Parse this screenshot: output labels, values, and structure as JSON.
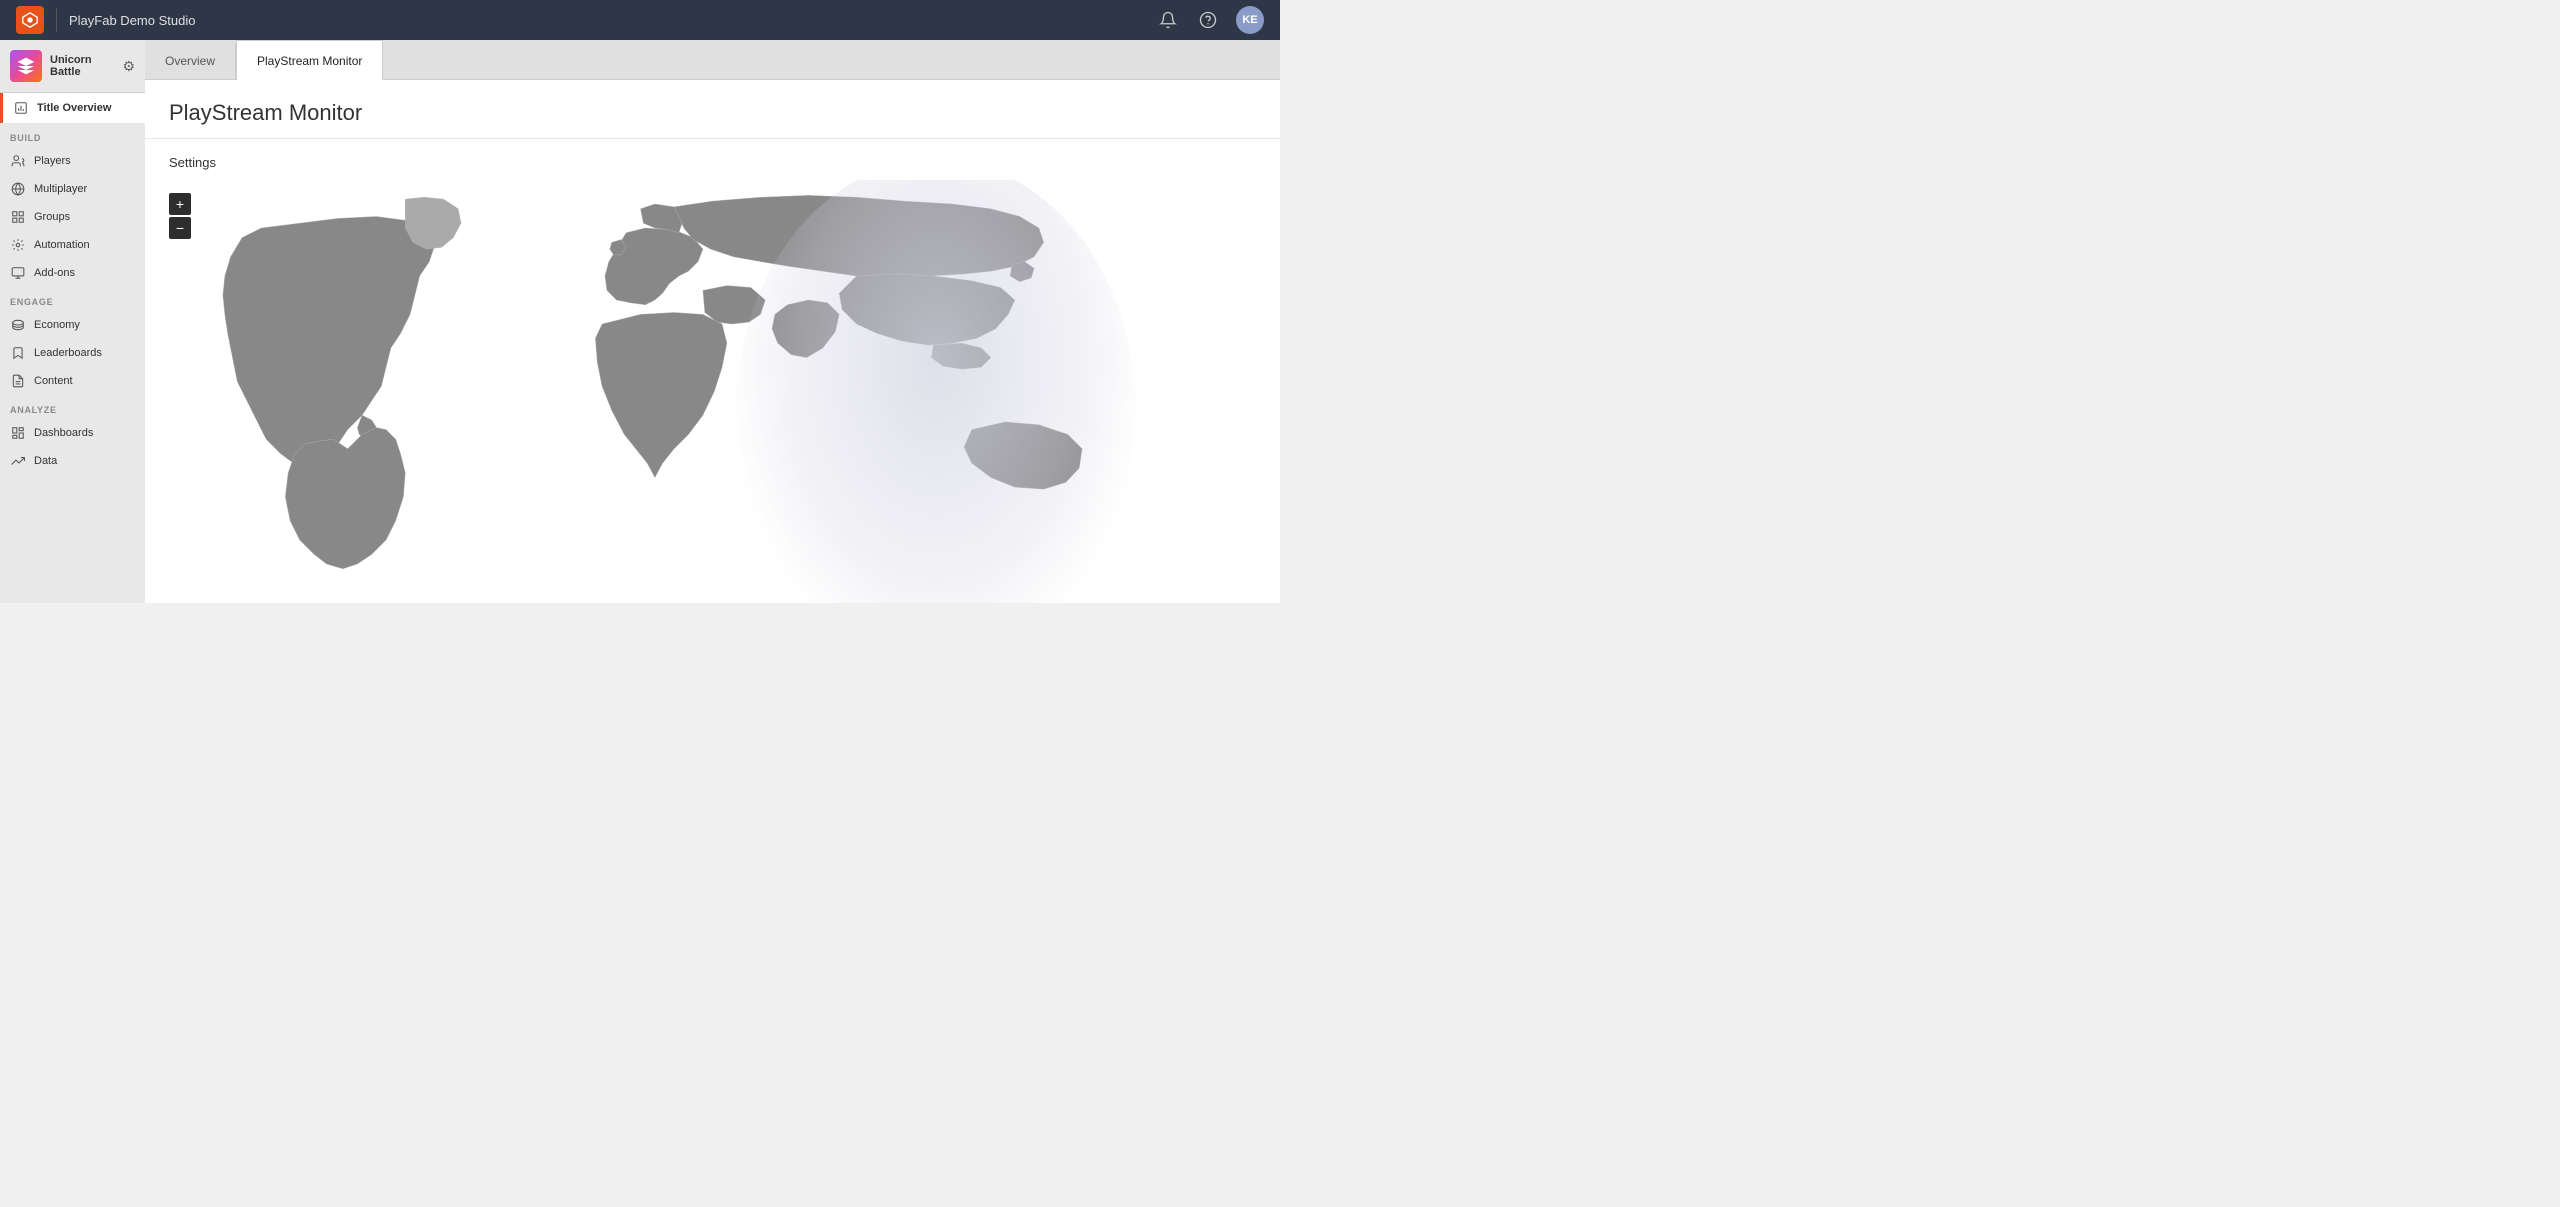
{
  "topbar": {
    "studio_name": "PlayFab Demo Studio",
    "user_initials": "KE"
  },
  "sidebar": {
    "game_title": "Unicorn Battle",
    "nav_active": "Title Overview",
    "sections": {
      "build": {
        "label": "BUILD",
        "items": [
          {
            "id": "players",
            "label": "Players"
          },
          {
            "id": "multiplayer",
            "label": "Multiplayer"
          },
          {
            "id": "groups",
            "label": "Groups"
          },
          {
            "id": "automation",
            "label": "Automation"
          },
          {
            "id": "addons",
            "label": "Add-ons"
          }
        ]
      },
      "engage": {
        "label": "ENGAGE",
        "items": [
          {
            "id": "economy",
            "label": "Economy"
          },
          {
            "id": "leaderboards",
            "label": "Leaderboards"
          },
          {
            "id": "content",
            "label": "Content"
          }
        ]
      },
      "analyze": {
        "label": "ANALYZE",
        "items": [
          {
            "id": "dashboards",
            "label": "Dashboards"
          },
          {
            "id": "data",
            "label": "Data"
          }
        ]
      }
    }
  },
  "tabs": [
    {
      "id": "overview",
      "label": "Overview",
      "active": false
    },
    {
      "id": "playstream",
      "label": "PlayStream Monitor",
      "active": true
    }
  ],
  "page": {
    "title": "PlayStream Monitor",
    "settings_label": "Settings",
    "zoom_plus": "+",
    "zoom_minus": "−"
  }
}
